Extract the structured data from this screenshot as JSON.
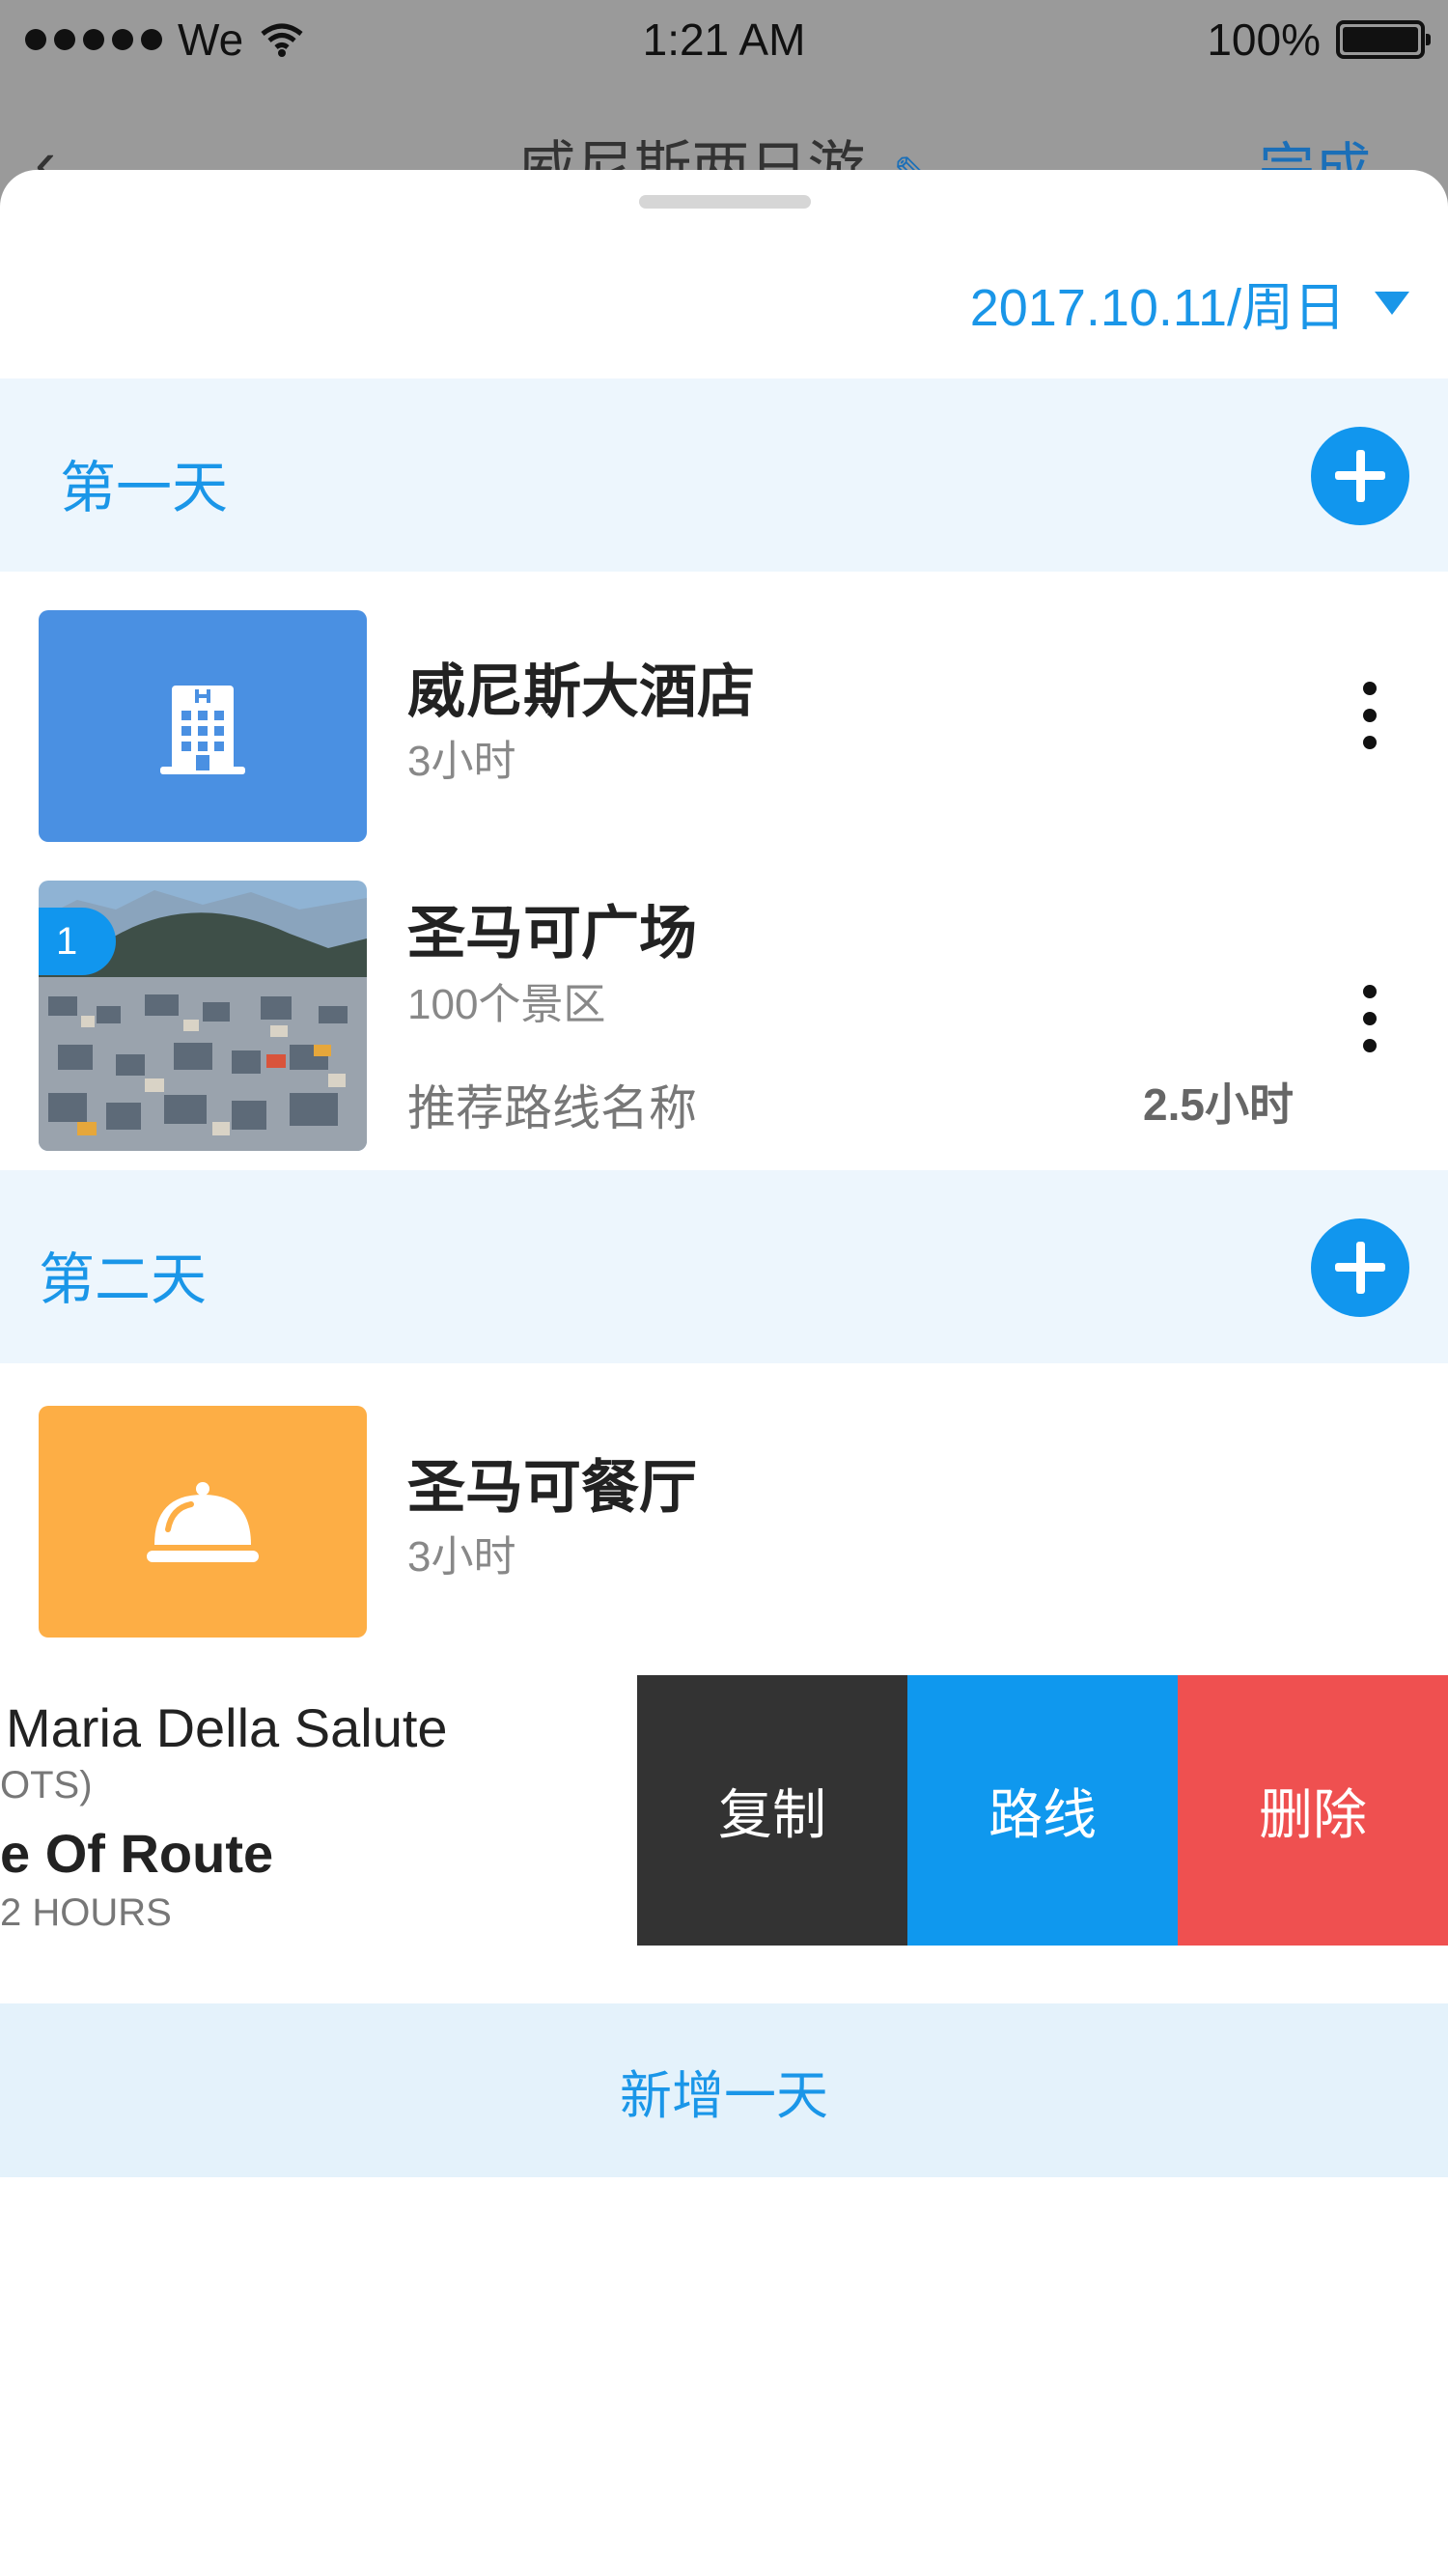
{
  "status_bar": {
    "carrier": "We",
    "time": "1:21 AM",
    "battery": "100%"
  },
  "nav": {
    "back_icon": "chevron-left-icon",
    "title": "威尼斯两日游",
    "edit_icon": "pencil-icon",
    "done_label": "完成"
  },
  "sheet": {
    "date": "2017.10.11/周日"
  },
  "days": [
    {
      "label": "第一天",
      "items": [
        {
          "type": "hotel",
          "icon": "hotel-icon",
          "color": "#4a90e2",
          "name": "威尼斯大酒店",
          "sub": "3小时"
        },
        {
          "type": "spot",
          "badge": "1",
          "name": "圣马可广场",
          "sub": "100个景区",
          "route": "推荐路线名称",
          "duration": "2.5小时"
        }
      ]
    },
    {
      "label": "第二天",
      "items": [
        {
          "type": "restaurant",
          "icon": "cloche-icon",
          "color": "#fdae45",
          "name": "圣马可餐厅",
          "sub": "3小时"
        }
      ]
    }
  ],
  "swiped_item": {
    "name": " Maria Della Salute",
    "spots": "OTS)",
    "route": "e Of Route",
    "duration": "2 HOURS",
    "actions": [
      {
        "label": "复制",
        "color": "#333333"
      },
      {
        "label": "路线",
        "color": "#0f98ee"
      },
      {
        "label": "删除",
        "color": "#ef5050"
      }
    ]
  },
  "add_day_label": "新增一天"
}
